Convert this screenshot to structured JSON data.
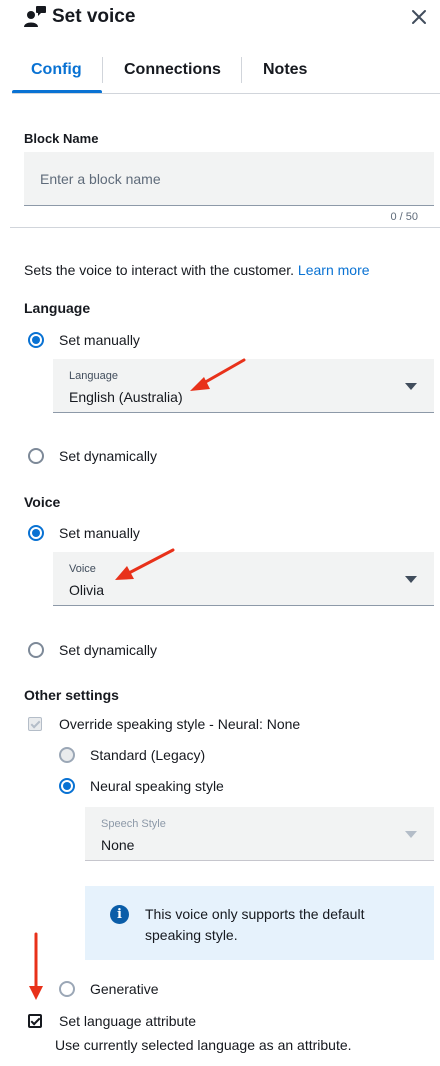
{
  "header": {
    "title": "Set voice",
    "icon": "voice-person-icon"
  },
  "tabs": [
    {
      "label": "Config",
      "active": true
    },
    {
      "label": "Connections",
      "active": false
    },
    {
      "label": "Notes",
      "active": false
    }
  ],
  "block_name": {
    "label": "Block Name",
    "placeholder": "Enter a block name",
    "value": "",
    "counter": "0 / 50"
  },
  "description": {
    "text": "Sets the voice to interact with the customer.",
    "link": "Learn more"
  },
  "language": {
    "heading": "Language",
    "set_manually": "Set manually",
    "select_label": "Language",
    "select_value": "English (Australia)",
    "set_dynamically": "Set dynamically"
  },
  "voice": {
    "heading": "Voice",
    "set_manually": "Set manually",
    "select_label": "Voice",
    "select_value": "Olivia",
    "set_dynamically": "Set dynamically"
  },
  "other_settings": {
    "heading": "Other settings",
    "override_label": "Override speaking style - Neural: None",
    "standard": "Standard (Legacy)",
    "neural": "Neural speaking style",
    "speech_style_label": "Speech Style",
    "speech_style_value": "None",
    "info": "This voice only supports the default speaking style.",
    "generative": "Generative",
    "set_language_attr": "Set language attribute",
    "set_language_attr_desc": "Use currently selected language as an attribute."
  },
  "colors": {
    "accent": "#0972d3",
    "annotation_arrow": "#e8311a",
    "info_bg": "#e6f2fc"
  }
}
